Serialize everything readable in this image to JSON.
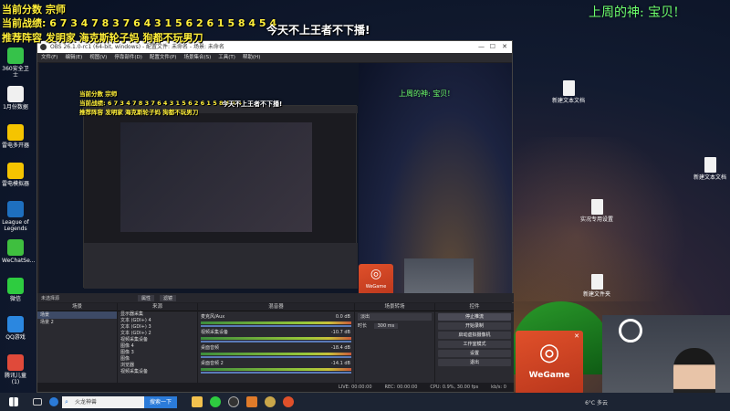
{
  "overlay": {
    "score_line": "当前分数 宗师",
    "record_line": "当前战绩: 6 7 3 4 7 8 3 7 6 4 3 1 5 6 2 6 1 5 8 4 5 4",
    "lineup_line": "推荐阵容 发明家 海克斯轮子妈 狗都不玩男刀",
    "slogan": "今天不上王者不下播!",
    "weekly_god": "上周的神: 宝贝!"
  },
  "desktop_left_icons": [
    {
      "label": "360安全卫士",
      "color": "#36c24a"
    },
    {
      "label": "1月份数据",
      "color": "#f0f0f0"
    },
    {
      "label": "雷电多开器",
      "color": "#f5c400"
    },
    {
      "label": "雷电模拟器",
      "color": "#f5c400"
    },
    {
      "label": "League of Legends",
      "color": "#1e6fbf"
    },
    {
      "label": "WeChatSe...",
      "color": "#3fbf3f"
    },
    {
      "label": "微信",
      "color": "#2ecc40"
    },
    {
      "label": "QQ游戏",
      "color": "#2b87e0"
    },
    {
      "label": "腾讯儿童(1)",
      "color": "#e04a3a"
    }
  ],
  "desktop_right_icons": [
    {
      "label": "新建文本文档"
    },
    {
      "label": "新建文本文档"
    },
    {
      "label": "实况专用设置"
    },
    {
      "label": "新建文件夹"
    }
  ],
  "obs": {
    "title": "OBS 26.1.0-rc1 (64-bit, windows) - 配置文件: 未命名 - 场景: 未命名",
    "menu": [
      "文件(F)",
      "编辑(E)",
      "视图(V)",
      "停靠部件(D)",
      "配置文件(P)",
      "场景集合(S)",
      "工具(T)",
      "帮助(H)"
    ],
    "no_source_selected": "未选择源",
    "properties_btn": "属性",
    "filters_btn": "滤镜",
    "docks": {
      "scenes": {
        "title": "场景",
        "items": [
          "场景",
          "场景 2"
        ]
      },
      "sources": {
        "title": "来源",
        "items": [
          "显示器采集",
          "文本 (GDI+) 4",
          "文本 (GDI+) 3",
          "文本 (GDI+) 2",
          "视频采集设备",
          "图像 4",
          "图像 3",
          "图像",
          "浏览器",
          "视频采集设备"
        ]
      },
      "mixer": {
        "title": "混音器",
        "channels": [
          {
            "name": "麦克风/Aux",
            "db": "0.0 dB"
          },
          {
            "name": "视频采集设备",
            "db": "-10.7 dB"
          },
          {
            "name": "桌面音频",
            "db": "-18.4 dB"
          },
          {
            "name": "桌面音频 2",
            "db": "-14.1 dB"
          }
        ]
      },
      "transitions": {
        "title": "场景转场",
        "type": "淡出",
        "duration_label": "时长",
        "duration": "300 ms"
      },
      "controls": {
        "title": "控件",
        "buttons": [
          "停止推流",
          "开始录制",
          "启动虚拟摄像机",
          "工作室模式",
          "设置",
          "退出"
        ]
      }
    },
    "status": {
      "live": "LIVE: 00:00:00",
      "rec": "REC: 00:00:00",
      "cpu": "CPU: 0.9%, 30.00 fps",
      "bitrate": "kb/s: 0"
    }
  },
  "wegame": {
    "label": "WeGame"
  },
  "taskbar": {
    "search_placeholder": "火龙神兽",
    "search_button": "搜索一下",
    "weather": "6°C 多云",
    "start_icon": "windows-start-icon"
  },
  "colors": {
    "overlay_yellow": "#ffef3a",
    "overlay_green": "#6dff6d",
    "obs_bg": "#1f1f24",
    "wegame_orange": "#e0502a"
  }
}
